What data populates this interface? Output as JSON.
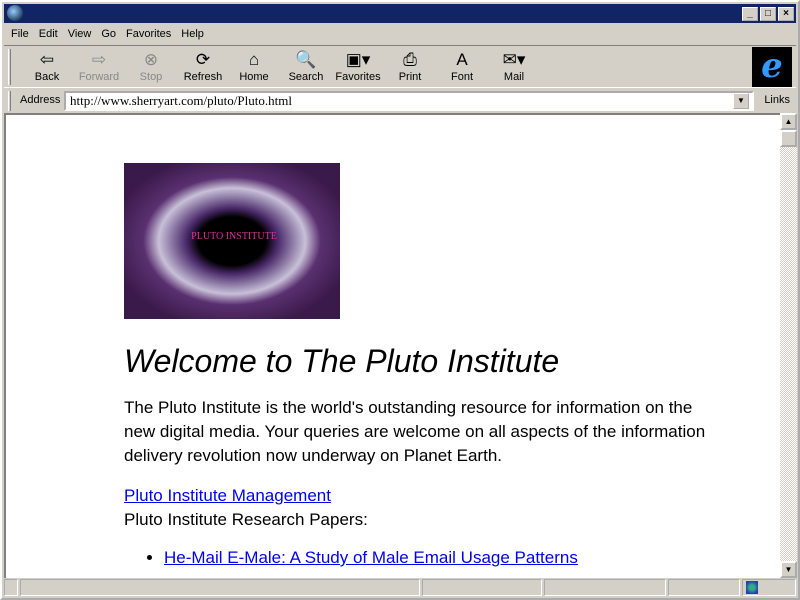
{
  "menu": [
    "File",
    "Edit",
    "View",
    "Go",
    "Favorites",
    "Help"
  ],
  "toolbar": [
    {
      "label": "Back",
      "icon": "back-arrow",
      "g": "⇦"
    },
    {
      "label": "Forward",
      "icon": "forward-arrow",
      "g": "⇨",
      "disabled": true
    },
    {
      "label": "Stop",
      "icon": "stop",
      "g": "⊗",
      "disabled": true
    },
    {
      "label": "Refresh",
      "icon": "refresh",
      "g": "⟳"
    },
    {
      "label": "Home",
      "icon": "home",
      "g": "⌂"
    },
    {
      "label": "Search",
      "icon": "search",
      "g": "🔍"
    },
    {
      "label": "Favorites",
      "icon": "favorites",
      "g": "▣▾"
    },
    {
      "label": "Print",
      "icon": "print",
      "g": "⎙"
    },
    {
      "label": "Font",
      "icon": "font",
      "g": "A"
    },
    {
      "label": "Mail",
      "icon": "mail",
      "g": "✉▾"
    }
  ],
  "address": {
    "label": "Address",
    "url": "http://www.sherryart.com/pluto/Pluto.html"
  },
  "links_label": "Links",
  "page": {
    "logo_text": "PLUTO INSTITUTE",
    "heading": "Welcome to The Pluto Institute",
    "intro": "The Pluto Institute is the world's outstanding resource for information on the new digital media. Your queries are welcome on all aspects of the information delivery revolution now underway on Planet Earth.",
    "management_link": "Pluto Institute Management ",
    "papers_label": "Pluto Institute Research Papers:",
    "papers": [
      "He-Mail E-Male: A Study of Male Email Usage Patterns"
    ]
  }
}
